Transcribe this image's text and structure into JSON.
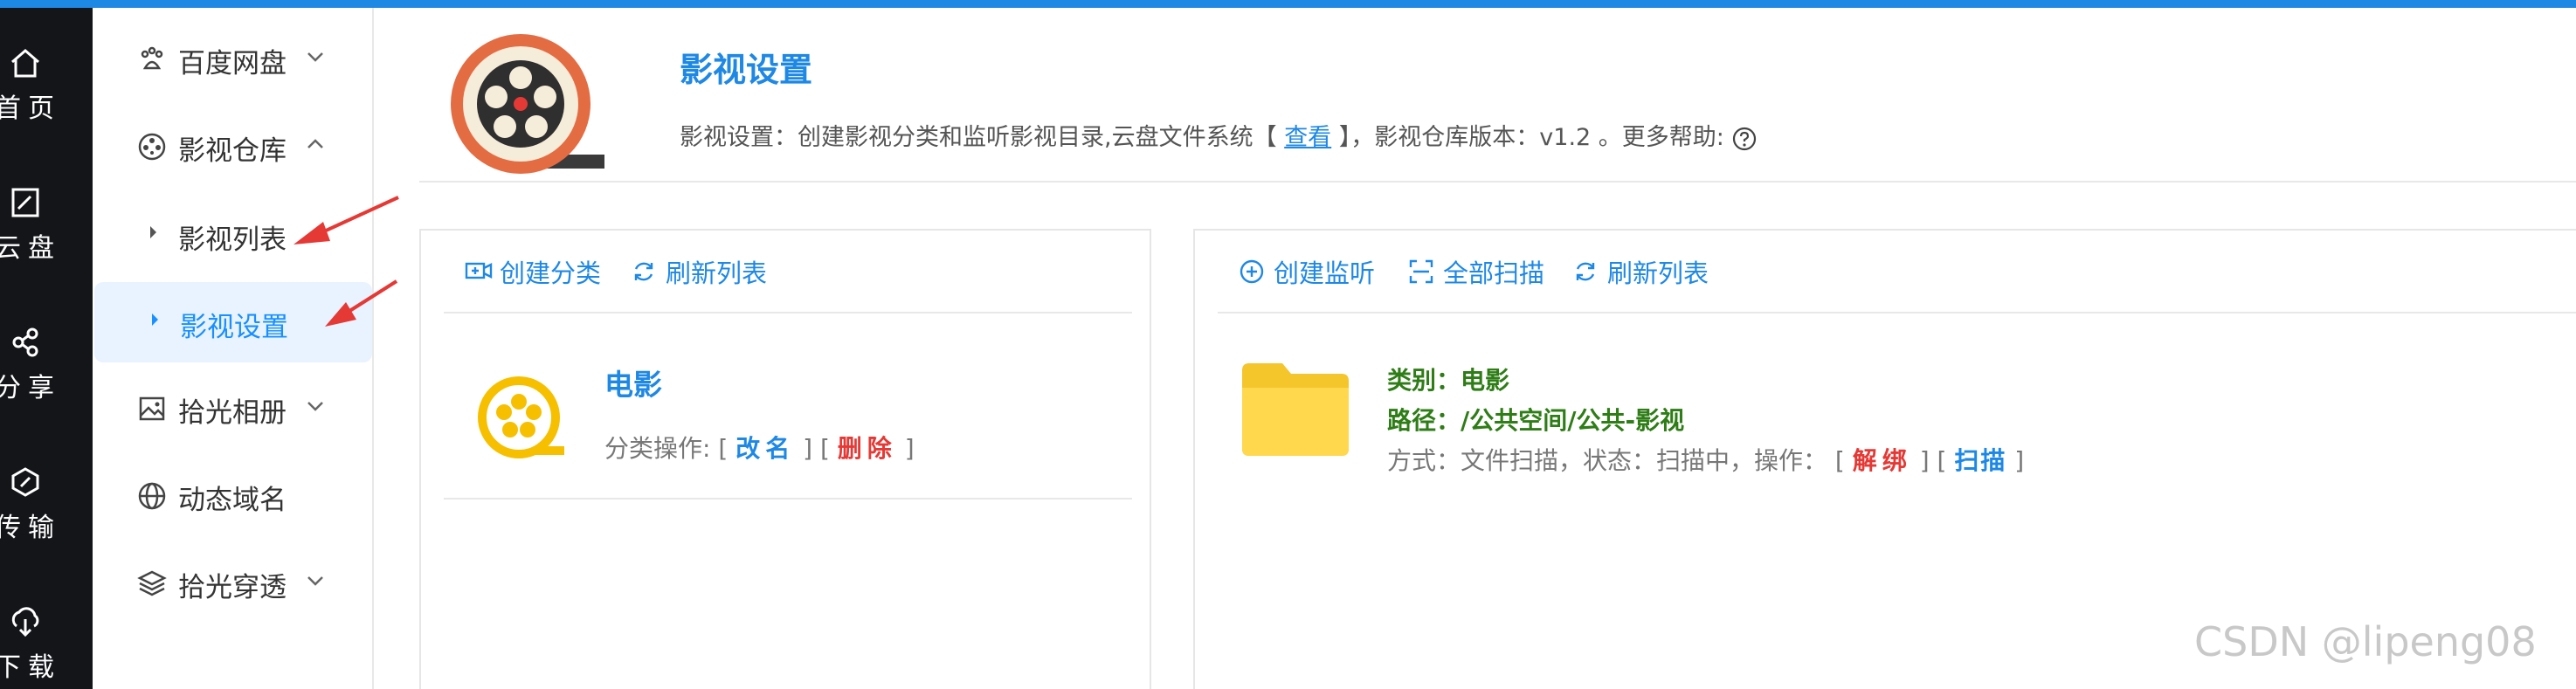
{
  "leftnav": {
    "items": [
      {
        "label": "首页",
        "icon": "home-icon"
      },
      {
        "label": "云盘",
        "icon": "disk-icon"
      },
      {
        "label": "分享",
        "icon": "share-icon"
      },
      {
        "label": "传输",
        "icon": "transfer-icon"
      },
      {
        "label": "下载",
        "icon": "download-icon"
      }
    ]
  },
  "sidebar": {
    "items": [
      {
        "label": "百度网盘",
        "icon": "paw-icon",
        "expanded": false
      },
      {
        "label": "影视仓库",
        "icon": "film-reel-icon",
        "expanded": true
      },
      {
        "label": "影视列表"
      },
      {
        "label": "影视设置",
        "active": true
      },
      {
        "label": "拾光相册",
        "icon": "photo-icon",
        "expanded": false
      },
      {
        "label": "动态域名",
        "icon": "globe-icon"
      },
      {
        "label": "拾光穿透",
        "icon": "layers-icon",
        "expanded": false
      }
    ]
  },
  "header": {
    "title": "影视设置",
    "desc_prefix": "影视设置：创建影视分类和监听影视目录,云盘文件系统【",
    "desc_link": "查看",
    "desc_suffix": "】，影视仓库版本：v1.2 。更多帮助:"
  },
  "left_panel": {
    "toolbar": {
      "create": "创建分类",
      "refresh": "刷新列表"
    },
    "category": {
      "name": "电影",
      "ops_label": "分类操作:",
      "lb1": "[",
      "rename": "改名",
      "rb1": "]",
      "lb2": "[",
      "delete": "删除",
      "rb2": "]"
    }
  },
  "right_panel": {
    "toolbar": {
      "watch": "创建监听",
      "scan_all": "全部扫描",
      "refresh": "刷新列表"
    },
    "watch": {
      "type_line": "类别：电影",
      "path_line": "路径：/公共空间/公共-影视",
      "meta": "方式：文件扫描，状态：扫描中，操作：",
      "lb1": "[",
      "unbind": "解绑",
      "rb1": "]",
      "lb2": "[",
      "scan": "扫描",
      "rb2": "]"
    }
  },
  "watermark": "CSDN @lipeng08",
  "colors": {
    "accent": "#1e88e5",
    "danger": "#e53935",
    "success": "#2e7d16",
    "nav_bg": "#131519"
  }
}
